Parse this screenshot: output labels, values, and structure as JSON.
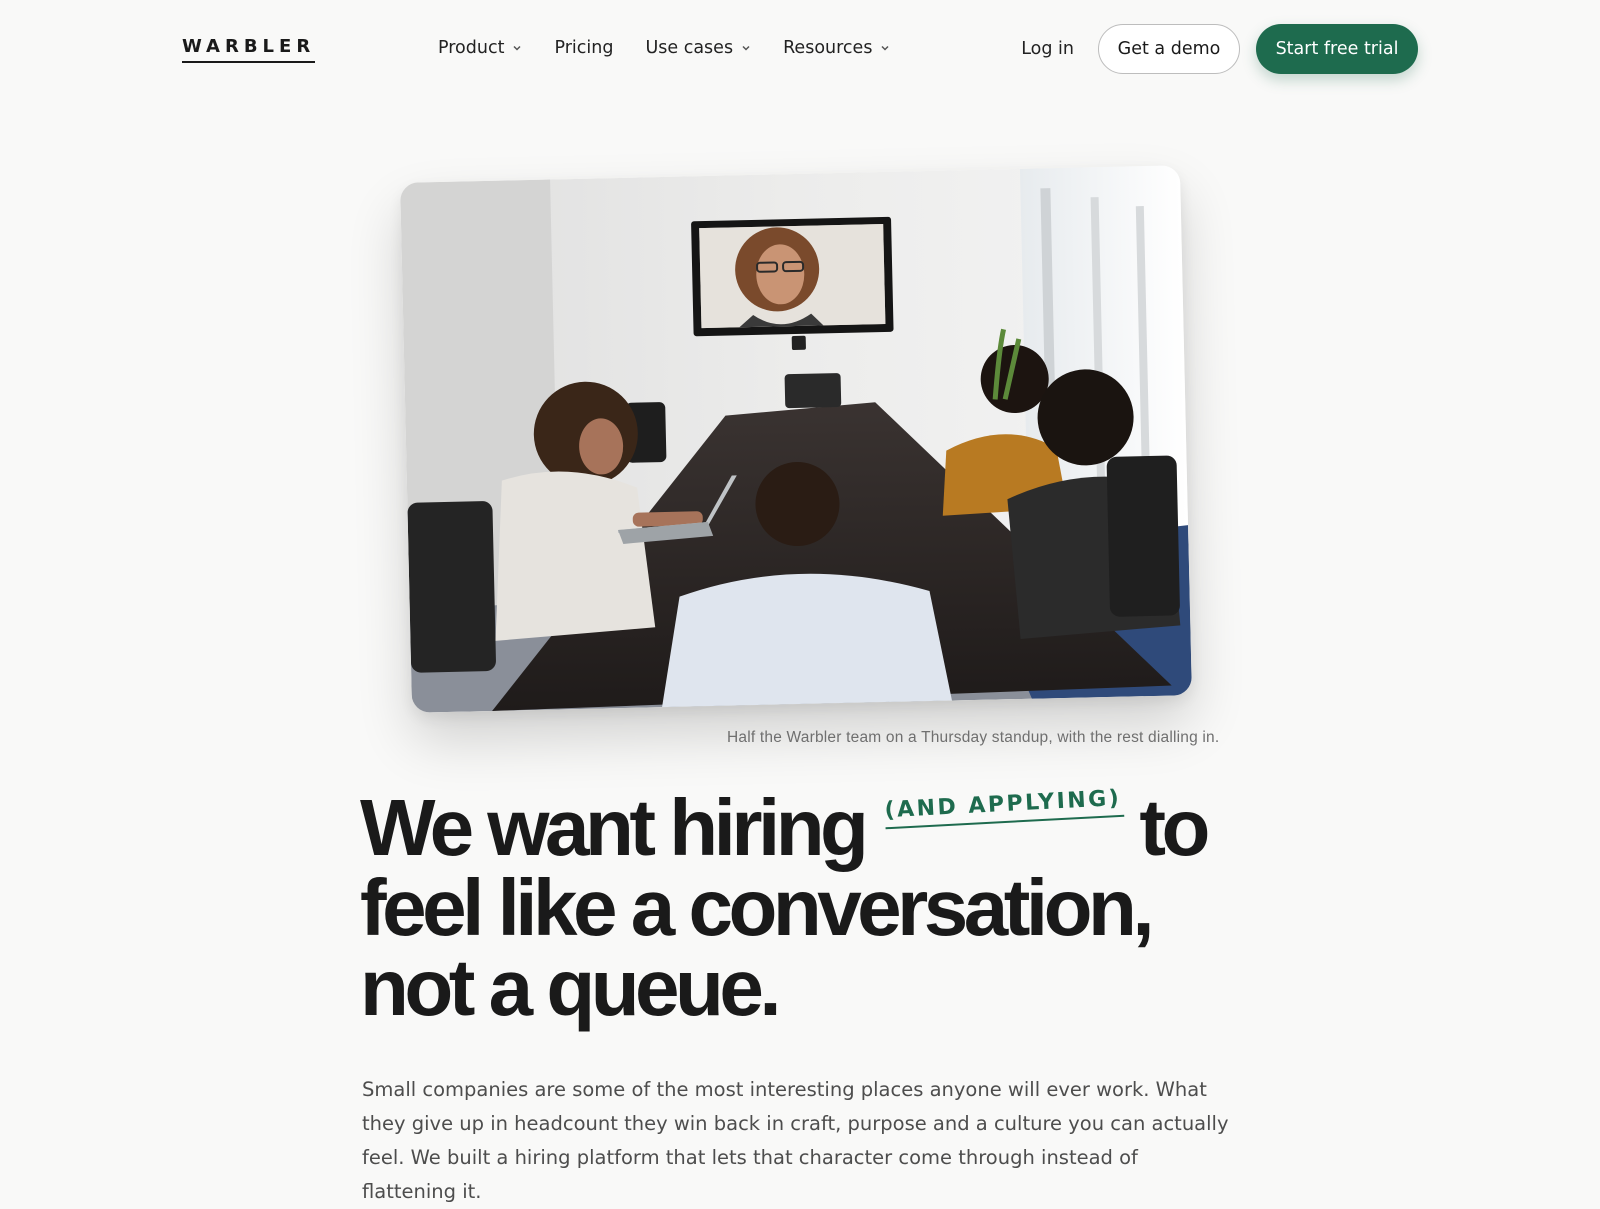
{
  "brand": {
    "logo": "WARBLER",
    "accent_color": "#1e6b4e"
  },
  "nav": {
    "items": [
      {
        "label": "Product",
        "has_dropdown": true
      },
      {
        "label": "Pricing",
        "has_dropdown": false
      },
      {
        "label": "Use cases",
        "has_dropdown": true
      },
      {
        "label": "Resources",
        "has_dropdown": true
      }
    ],
    "login_label": "Log in",
    "demo_label": "Get a demo",
    "trial_label": "Start free trial"
  },
  "hero": {
    "image_alt": "Team meeting around a conference table with a remote colleague on a wall-mounted screen",
    "caption": "Half the Warbler team on a Thursday standup, with the rest dialling in.",
    "headline": {
      "line1_a": "We want hiring",
      "aside": "(AND APPLYING)",
      "line1_b": "to",
      "line2": "feel like a conversation,",
      "line3": "not a queue."
    },
    "body": "Small companies are some of the most interesting places anyone will ever work. What they give up in headcount they win back in craft, purpose and a culture you can actually feel. We built a hiring platform that lets that character come through instead of flattening it."
  }
}
